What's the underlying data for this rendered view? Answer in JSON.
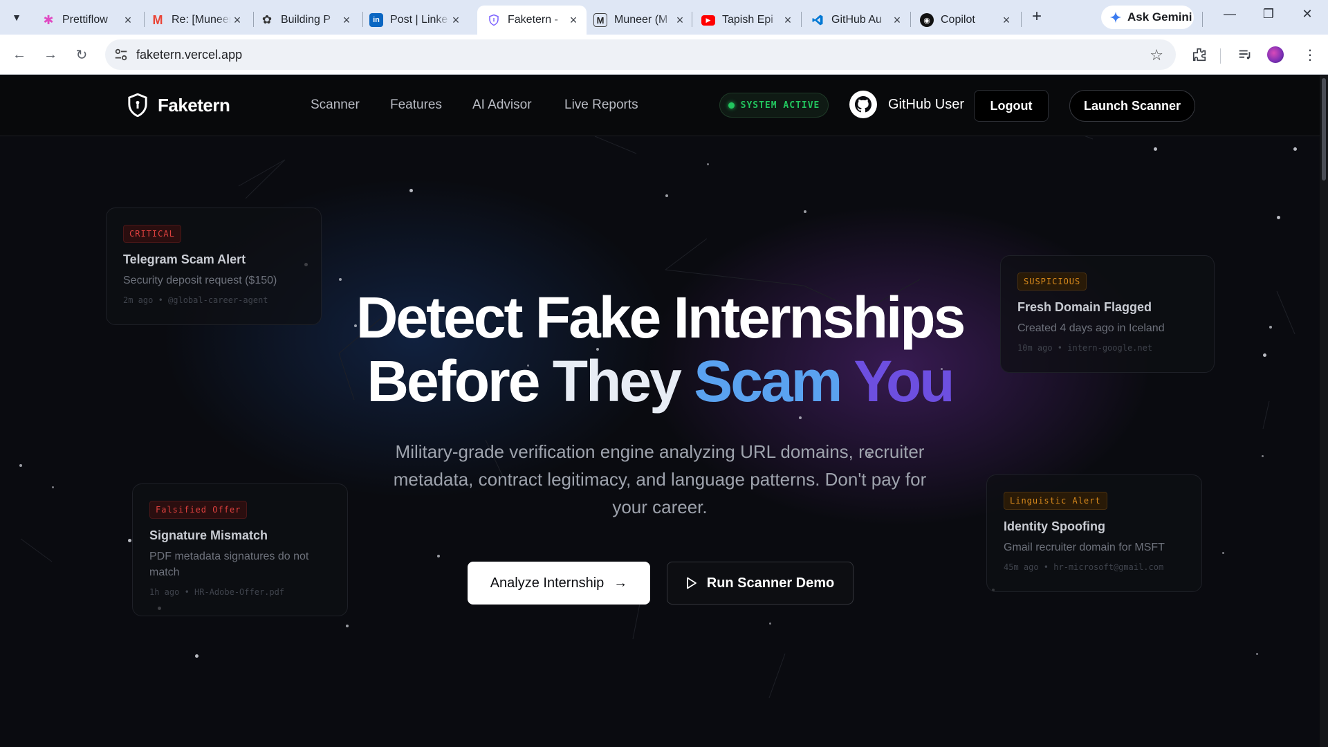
{
  "browser": {
    "tabs": [
      {
        "title": "Prettiflow",
        "favicon": "prettiflow-icon",
        "color": "#e04ac2"
      },
      {
        "title": "Re: [Muneer",
        "favicon": "gmail-icon",
        "color": "#ea4335"
      },
      {
        "title": "Building P",
        "favicon": "openai-icon",
        "color": "#333333"
      },
      {
        "title": "Post | Linke",
        "favicon": "linkedin-icon",
        "color": "#0a66c2"
      },
      {
        "title": "Faketern -",
        "favicon": "faketern-shield-icon",
        "color": "#7b61ff",
        "active": true
      },
      {
        "title": "Muneer (M",
        "favicon": "medium-icon",
        "color": "#222222"
      },
      {
        "title": "Tapish Epi",
        "favicon": "youtube-icon",
        "color": "#ff0000"
      },
      {
        "title": "GitHub Au",
        "favicon": "vscode-icon",
        "color": "#0078d4"
      },
      {
        "title": "Copilot",
        "favicon": "github-icon",
        "color": "#111111"
      }
    ],
    "ask_gemini": "Ask Gemini",
    "url": "faketern.vercel.app"
  },
  "site": {
    "brand": "Faketern",
    "nav": [
      "Scanner",
      "Features",
      "AI Advisor",
      "Live Reports"
    ],
    "status_badge": "SYSTEM ACTIVE",
    "user": "GitHub User",
    "logout": "Logout",
    "launch": "Launch Scanner"
  },
  "hero": {
    "line1": "Detect Fake Internships",
    "line2_before": "Before ",
    "line2_they": "They ",
    "line2_scam": "Scam ",
    "line2_you": "You",
    "subtitle": "Military-grade verification engine analyzing URL domains, recruiter metadata, contract legitimacy, and language patterns. Don't pay for your career.",
    "primary_button": "Analyze Internship",
    "secondary_button": "Run Scanner Demo"
  },
  "alerts": [
    {
      "tag": "CRITICAL",
      "title": "Telegram Scam Alert",
      "desc": "Security deposit request ($150)",
      "meta": "2m ago • @global-career-agent"
    },
    {
      "tag": "SUSPICIOUS",
      "title": "Fresh Domain Flagged",
      "desc": "Created 4 days ago in Iceland",
      "meta": "10m ago • intern-google.net"
    },
    {
      "tag": "Falsified Offer",
      "title": "Signature Mismatch",
      "desc": "PDF metadata signatures do not match",
      "meta": "1h ago • HR-Adobe-Offer.pdf"
    },
    {
      "tag": "Linguistic Alert",
      "title": "Identity Spoofing",
      "desc": "Gmail recruiter domain for MSFT",
      "meta": "45m ago • hr-microsoft@gmail.com"
    }
  ],
  "colors": {
    "status_green": "#22c55e",
    "critical_red": "#e0413f",
    "warning_amber": "#d98a1c",
    "accent_blue": "#5aa2f0",
    "accent_purple": "#6d4fe0"
  }
}
